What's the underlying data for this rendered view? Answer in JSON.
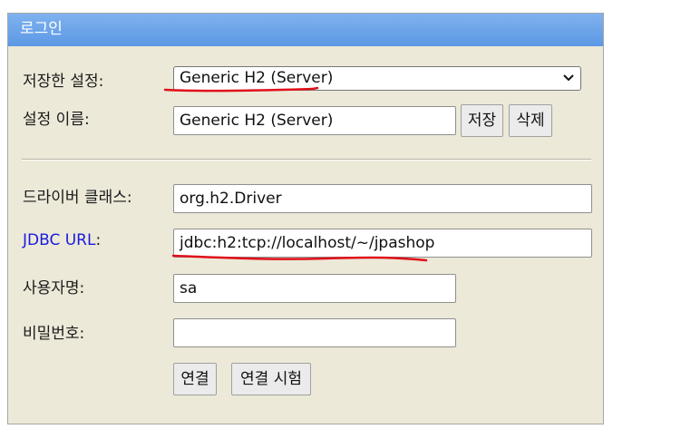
{
  "window": {
    "title": "로그인"
  },
  "form": {
    "saved_settings": {
      "label": "저장한 설정:",
      "selected": "Generic H2 (Server)"
    },
    "setting_name": {
      "label": "설정 이름:",
      "value": "Generic H2 (Server)",
      "save_button": "저장",
      "delete_button": "삭제"
    },
    "driver_class": {
      "label": "드라이버 클래스:",
      "value": "org.h2.Driver"
    },
    "jdbc_url": {
      "label": "JDBC URL",
      "colon": ":",
      "value": "jdbc:h2:tcp://localhost/~/jpashop"
    },
    "username": {
      "label": "사용자명:",
      "value": "sa"
    },
    "password": {
      "label": "비밀번호:",
      "value": ""
    },
    "connect_button": "연결",
    "test_connection_button": "연결 시험"
  },
  "annotation_color": "#e0101a"
}
